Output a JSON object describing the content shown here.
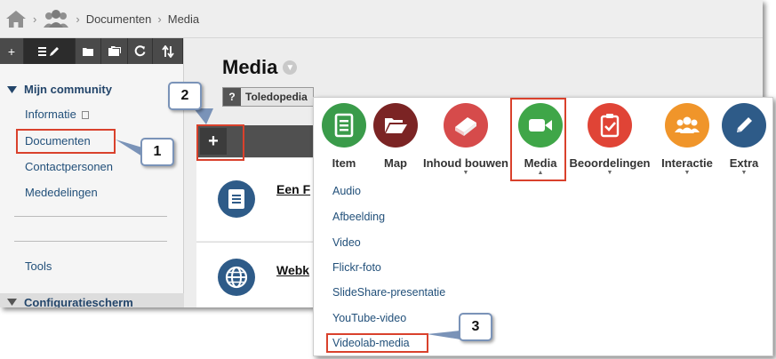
{
  "breadcrumb": {
    "documenten": "Documenten",
    "media": "Media",
    "separator": "›"
  },
  "sidebar": {
    "community": "Mijn community",
    "items": [
      {
        "label": "Informatie"
      },
      {
        "label": "Documenten"
      },
      {
        "label": "Contactpersonen"
      },
      {
        "label": "Mededelingen"
      },
      {
        "label": "Tools"
      }
    ],
    "config": "Configuratiescherm"
  },
  "main": {
    "title": "Media",
    "tag": "Toledopedia",
    "plus": "+",
    "rows": [
      {
        "title": "Een F"
      },
      {
        "title": "Webk"
      }
    ]
  },
  "panel": {
    "tools": [
      {
        "label": "Item",
        "color": "#3a9b4a"
      },
      {
        "label": "Map",
        "color": "#7b2424"
      },
      {
        "label": "Inhoud bouwen",
        "color": "#d64b4b"
      },
      {
        "label": "Media",
        "color": "#3fa648"
      },
      {
        "label": "Beoordelingen",
        "color": "#e04436"
      },
      {
        "label": "Interactie",
        "color": "#f0952a"
      },
      {
        "label": "Extra",
        "color": "#2e5b88"
      }
    ],
    "menu": [
      "Audio",
      "Afbeelding",
      "Video",
      "Flickr-foto",
      "SlideShare-presentatie",
      "YouTube-video",
      "Videolab-media"
    ]
  },
  "callouts": {
    "one": "1",
    "two": "2",
    "three": "3"
  },
  "colors": {
    "highlight": "#d9412c",
    "callout_border": "#7a93b8",
    "link": "#22507a"
  }
}
